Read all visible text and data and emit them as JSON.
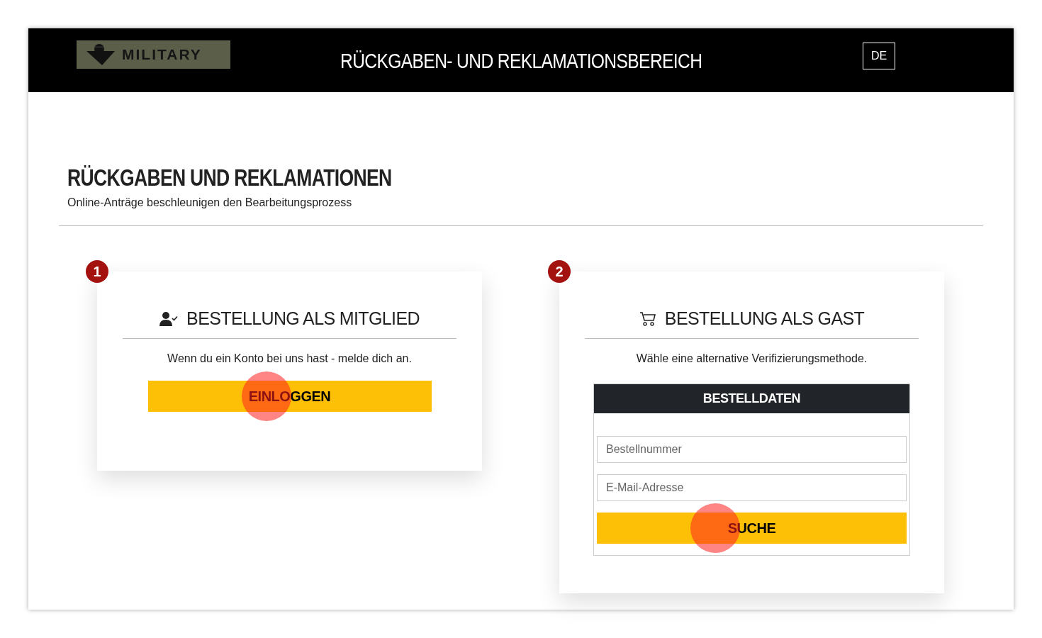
{
  "header": {
    "logo_text": "MILITARY",
    "title": "RÜCKGABEN- UND REKLAMATIONSBEREICH",
    "language": "DE"
  },
  "page": {
    "heading": "RÜCKGABEN UND REKLAMATIONEN",
    "subtitle": "Online-Anträge beschleunigen den Bearbeitungsprozess"
  },
  "cards": [
    {
      "step": "1",
      "kind": "member",
      "title": "BESTELLUNG ALS MITGLIED",
      "text": "Wenn du ein Konto bei uns hast - melde dich an.",
      "button": {
        "label": "EINLOGGEN",
        "clicked": true
      }
    },
    {
      "step": "2",
      "kind": "guest",
      "title": "BESTELLUNG ALS GAST",
      "text": "Wähle eine alternative Verifizierungsmethode.",
      "form": {
        "title": "BESTELLDATEN",
        "fields": [
          {
            "placeholder": "Bestellnummer"
          },
          {
            "placeholder": "E-Mail-Adresse"
          }
        ]
      },
      "button": {
        "label": "SUCHE",
        "clicked": true
      }
    }
  ]
}
